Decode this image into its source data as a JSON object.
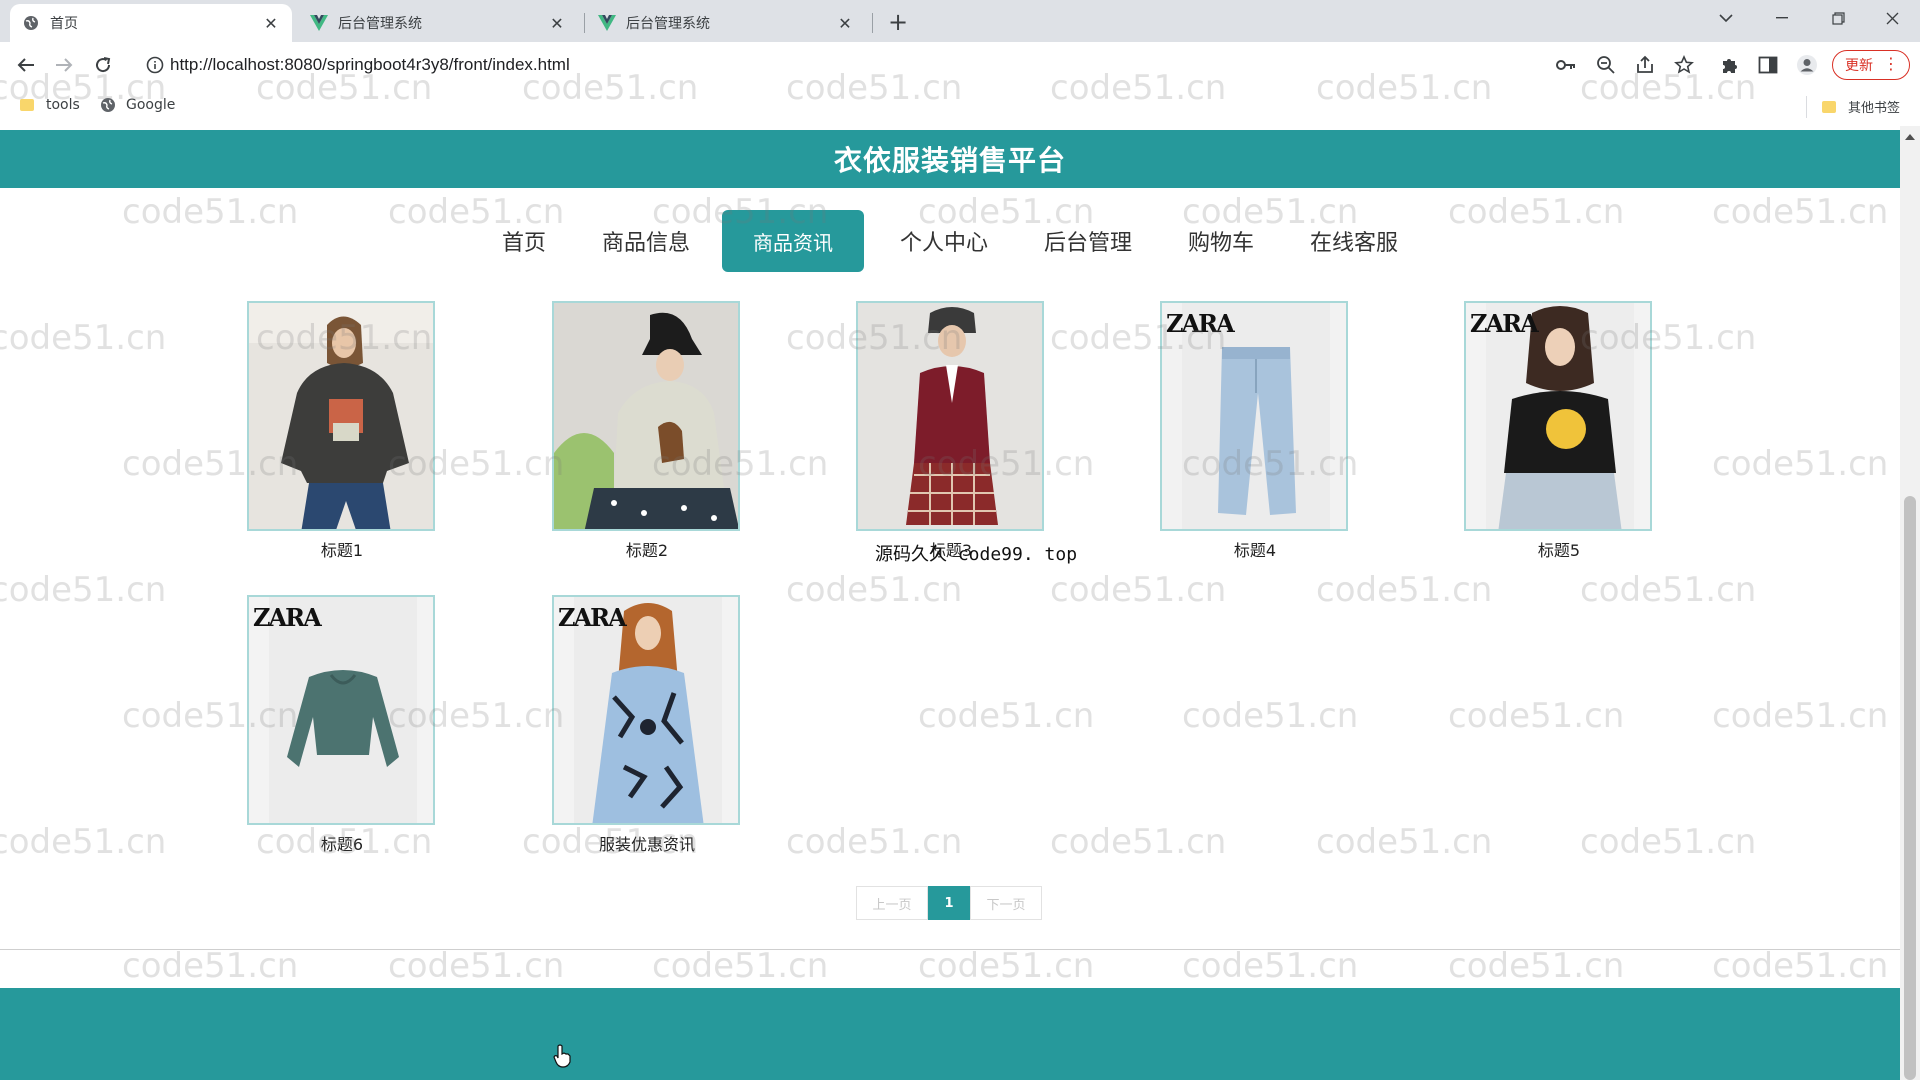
{
  "browser": {
    "tabs": [
      {
        "title": "首页",
        "active": true
      },
      {
        "title": "后台管理系统",
        "active": false
      },
      {
        "title": "后台管理系统",
        "active": false
      }
    ],
    "url": "http://localhost:8080/springboot4r3y8/front/index.html",
    "update_label": "更新",
    "bookmarks": [
      {
        "label": "tools",
        "icon": "folder-icon"
      },
      {
        "label": "Google",
        "icon": "globe-icon"
      }
    ],
    "other_bookmarks": "其他书签"
  },
  "site": {
    "title": "衣依服装销售平台",
    "nav": [
      {
        "label": "首页",
        "active": false
      },
      {
        "label": "商品信息",
        "active": false
      },
      {
        "label": "商品资讯",
        "active": true
      },
      {
        "label": "个人中心",
        "active": false
      },
      {
        "label": "后台管理",
        "active": false
      },
      {
        "label": "购物车",
        "active": false
      },
      {
        "label": "在线客服",
        "active": false
      }
    ],
    "products": [
      {
        "caption": "标题1",
        "image": "grey-sweatshirt"
      },
      {
        "caption": "标题2",
        "image": "bucket-hat-sweater"
      },
      {
        "caption": "标题3",
        "image": "burgundy-cardigan"
      },
      {
        "caption": "标题4",
        "image": "zara-jeans"
      },
      {
        "caption": "标题5",
        "image": "zara-tshirt"
      },
      {
        "caption": "标题6",
        "image": "zara-green-sweatshirt"
      },
      {
        "caption": "服装优惠资讯",
        "image": "zara-floral-dress"
      }
    ],
    "brand_text": "ZARA",
    "overlay_text": "源码久久 code99. top",
    "pager": {
      "prev": "上一页",
      "current": "1",
      "next": "下一页"
    }
  },
  "watermark": "code51.cn",
  "colors": {
    "accent": "#26999b"
  }
}
